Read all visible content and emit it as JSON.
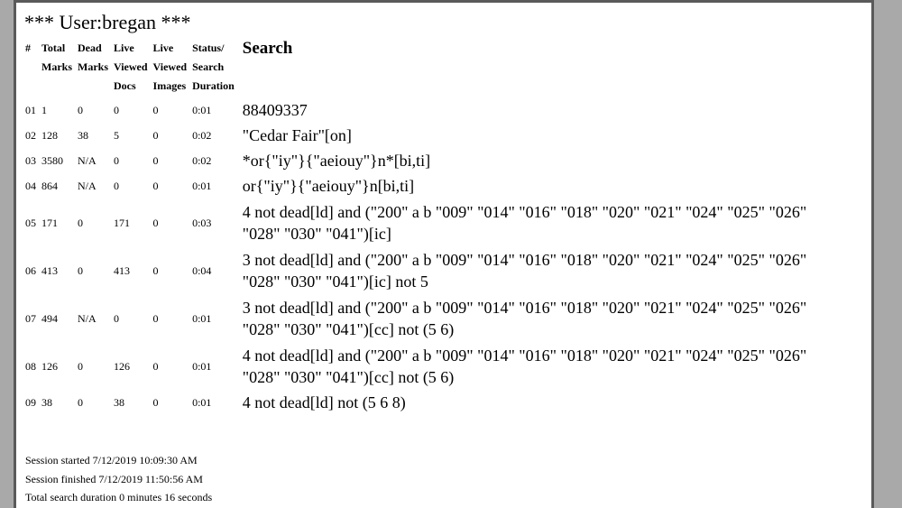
{
  "page": {
    "title": "*** User:bregan ***"
  },
  "table": {
    "headers": {
      "num": "#",
      "total_marks": [
        "Total",
        "Marks"
      ],
      "dead_marks": [
        "Dead",
        "Marks"
      ],
      "live_docs": [
        "Live",
        "Viewed",
        "Docs"
      ],
      "live_images": [
        "Live",
        "Viewed",
        "Images"
      ],
      "status": [
        "Status/",
        "Search",
        "Duration"
      ],
      "search": "Search"
    },
    "rows": [
      {
        "num": "01",
        "total": "1",
        "dead": "0",
        "docs": "0",
        "images": "0",
        "duration": "0:01",
        "query": "88409337"
      },
      {
        "num": "02",
        "total": "128",
        "dead": "38",
        "docs": "5",
        "images": "0",
        "duration": "0:02",
        "query": "\"Cedar Fair\"[on]"
      },
      {
        "num": "03",
        "total": "3580",
        "dead": "N/A",
        "docs": "0",
        "images": "0",
        "duration": "0:02",
        "query": "*or{\"iy\"}{\"aeiouy\"}n*[bi,ti]"
      },
      {
        "num": "04",
        "total": "864",
        "dead": "N/A",
        "docs": "0",
        "images": "0",
        "duration": "0:01",
        "query": "or{\"iy\"}{\"aeiouy\"}n[bi,ti]"
      },
      {
        "num": "05",
        "total": "171",
        "dead": "0",
        "docs": "171",
        "images": "0",
        "duration": "0:03",
        "query": "4 not dead[ld] and (\"200\" a b \"009\" \"014\" \"016\" \"018\" \"020\" \"021\" \"024\" \"025\" \"026\" \"028\" \"030\" \"041\")[ic]"
      },
      {
        "num": "06",
        "total": "413",
        "dead": "0",
        "docs": "413",
        "images": "0",
        "duration": "0:04",
        "query": "3 not dead[ld] and (\"200\" a b \"009\" \"014\" \"016\" \"018\" \"020\" \"021\" \"024\" \"025\" \"026\" \"028\" \"030\" \"041\")[ic] not 5"
      },
      {
        "num": "07",
        "total": "494",
        "dead": "N/A",
        "docs": "0",
        "images": "0",
        "duration": "0:01",
        "query": "3 not dead[ld] and (\"200\" a b \"009\" \"014\" \"016\" \"018\" \"020\" \"021\" \"024\" \"025\" \"026\" \"028\" \"030\" \"041\")[cc] not (5 6)"
      },
      {
        "num": "08",
        "total": "126",
        "dead": "0",
        "docs": "126",
        "images": "0",
        "duration": "0:01",
        "query": "4 not dead[ld] and (\"200\" a b \"009\" \"014\" \"016\" \"018\" \"020\" \"021\" \"024\" \"025\" \"026\" \"028\" \"030\" \"041\")[cc] not (5 6)"
      },
      {
        "num": "09",
        "total": "38",
        "dead": "0",
        "docs": "38",
        "images": "0",
        "duration": "0:01",
        "query": "4 not dead[ld] not (5 6 8)"
      }
    ]
  },
  "footer": {
    "session_started": "Session started 7/12/2019 10:09:30 AM",
    "session_finished": "Session finished 7/12/2019 11:50:56 AM",
    "total_duration": "Total search duration 0 minutes 16 seconds"
  }
}
